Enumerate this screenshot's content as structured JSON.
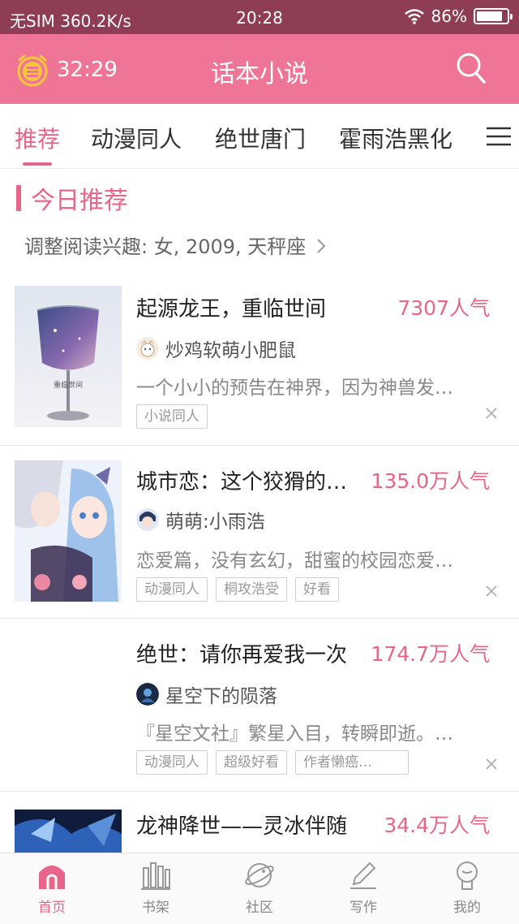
{
  "status_bar": {
    "carrier": "无SIM",
    "speed": "360.2K/s",
    "time": "20:28",
    "battery": "86%",
    "battery_level": 0.86
  },
  "header": {
    "timer": "32:29",
    "title": "话本小说",
    "search_icon": "search-icon"
  },
  "tabs": [
    {
      "label": "推荐"
    },
    {
      "label": "动漫同人"
    },
    {
      "label": "绝世唐门"
    },
    {
      "label": "霍雨浩黑化"
    }
  ],
  "section": {
    "title": "今日推荐",
    "interest": "调整阅读兴趣: 女, 2009, 天秤座"
  },
  "books": [
    {
      "title": "起源龙王，重临世间",
      "popularity": "7307人气",
      "author": "炒鸡软萌小肥鼠",
      "description": "一个小小的预告在神界，因为神兽发…",
      "tags": [
        "小说同人"
      ],
      "cover_text": "重临世间"
    },
    {
      "title": "城市恋：这个狡猾的…",
      "popularity": "135.0万人气",
      "author": "萌萌:小雨浩",
      "description": "恋爱篇，没有玄幻，甜蜜的校园恋爱…",
      "tags": [
        "动漫同人",
        "桐攻浩受",
        "好看"
      ]
    },
    {
      "title": "绝世：请你再爱我一次",
      "popularity": "174.7万人气",
      "author": "星空下的陨落",
      "description": "『星空文社』繁星入目，转瞬即逝。…",
      "tags": [
        "动漫同人",
        "超级好看",
        "作者懒癌…"
      ]
    },
    {
      "title": "龙神降世——灵冰伴随",
      "popularity": "34.4万人气"
    }
  ],
  "tabbar": [
    {
      "label": "首页"
    },
    {
      "label": "书架"
    },
    {
      "label": "社区"
    },
    {
      "label": "写作"
    },
    {
      "label": "我的"
    }
  ],
  "colors": {
    "accent": "#e8658a",
    "header": "#ef7596",
    "status_bar": "#8f3c55"
  }
}
